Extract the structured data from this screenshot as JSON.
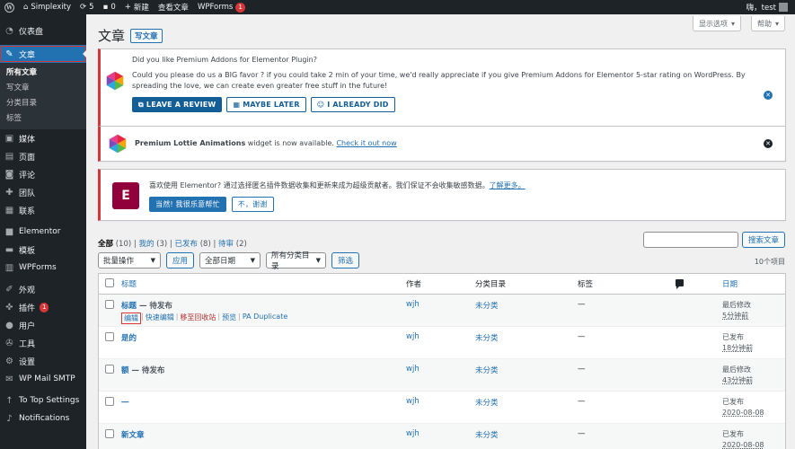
{
  "adminbar": {
    "site_name": "Simplexity",
    "updates_count": "5",
    "comments_count": "0",
    "new_label": "新建",
    "view_posts": "查看文章",
    "wpforms_label": "WPForms",
    "wpforms_badge": "1",
    "greeting": "嗨，test"
  },
  "sidebar": {
    "items": [
      {
        "label": "仪表盘",
        "icon": "dashboard-icon"
      },
      {
        "label": "文章",
        "icon": "pin-icon"
      },
      {
        "label": "媒体",
        "icon": "media-icon"
      },
      {
        "label": "页面",
        "icon": "page-icon"
      },
      {
        "label": "评论",
        "icon": "comment-icon"
      },
      {
        "label": "团队",
        "icon": "team-icon"
      },
      {
        "label": "联系",
        "icon": "contact-icon"
      },
      {
        "label": "Elementor",
        "icon": "elementor-icon"
      },
      {
        "label": "模板",
        "icon": "template-icon"
      },
      {
        "label": "WPForms",
        "icon": "wpforms-icon"
      },
      {
        "label": "外观",
        "icon": "appearance-icon"
      },
      {
        "label": "插件",
        "icon": "plugin-icon",
        "badge": "1"
      },
      {
        "label": "用户",
        "icon": "user-icon"
      },
      {
        "label": "工具",
        "icon": "tools-icon"
      },
      {
        "label": "设置",
        "icon": "settings-icon"
      },
      {
        "label": "WP Mail SMTP",
        "icon": "mail-icon"
      },
      {
        "label": "To Top Settings",
        "icon": "arrow-up-icon"
      },
      {
        "label": "Notifications",
        "icon": "bell-icon"
      }
    ],
    "submenu": [
      "所有文章",
      "写文章",
      "分类目录",
      "标签"
    ]
  },
  "header": {
    "title": "文章",
    "add_new": "写文章",
    "screen_options": "显示选项",
    "help": "帮助"
  },
  "notice_review": {
    "heading": "Did you like Premium Addons for Elementor Plugin?",
    "body": "Could you please do us a BIG favor ? if you could take 2 min of your time, we'd really appreciate if you give Premium Addons for Elementor 5-star rating on WordPress. By spreading the love, we can create even greater free stuff in the future!",
    "btn_review": "LEAVE A REVIEW",
    "btn_later": "MAYBE LATER",
    "btn_did": "I ALREADY DID"
  },
  "notice_lottie": {
    "bold": "Premium Lottie Animations",
    "text": " widget is now available.",
    "link": "Check it out now"
  },
  "notice_elementor": {
    "text": "喜欢使用 Elementor? 通过选择匿名插件数据收集和更新来成为超级贡献者。我们保证不会收集敏感数据。",
    "link": "了解更多。",
    "btn_yes": "当然! 我很乐意帮忙",
    "btn_no": "不，谢谢"
  },
  "filters": {
    "all": "全部",
    "all_count": "(10)",
    "mine": "我的",
    "mine_count": "(3)",
    "published": "已发布",
    "published_count": "(8)",
    "pending": "待审",
    "pending_count": "(2)",
    "search_button": "搜索文章",
    "bulk": "批量操作",
    "apply": "应用",
    "dates": "全部日期",
    "cats": "所有分类目录",
    "filter": "筛选",
    "items": "10个项目"
  },
  "table": {
    "headers": {
      "title": "标题",
      "author": "作者",
      "categories": "分类目录",
      "tags": "标签",
      "date": "日期"
    },
    "row_actions": {
      "edit": "编辑",
      "quick": "快速编辑",
      "trash": "移至回收站",
      "preview": "预览",
      "duplicate": "PA Duplicate"
    },
    "rows": [
      {
        "title": "标题",
        "state": " — 待发布",
        "author": "wjh",
        "category": "未分类",
        "tags": "—",
        "date_status": "最后修改",
        "date": "5分钟前"
      },
      {
        "title": "是的",
        "state": "",
        "author": "wjh",
        "category": "未分类",
        "tags": "—",
        "date_status": "已发布",
        "date": "18分钟前"
      },
      {
        "title": "额",
        "state": " — 待发布",
        "author": "wjh",
        "category": "未分类",
        "tags": "—",
        "date_status": "最后修改",
        "date": "43分钟前"
      },
      {
        "title": "一",
        "state": "",
        "author": "wjh",
        "category": "未分类",
        "tags": "—",
        "date_status": "已发布",
        "date": "2020-08-08"
      },
      {
        "title": "新文章",
        "state": "",
        "author": "wjh",
        "category": "未分类",
        "tags": "—",
        "date_status": "已发布",
        "date": "2020-08-08"
      }
    ]
  }
}
